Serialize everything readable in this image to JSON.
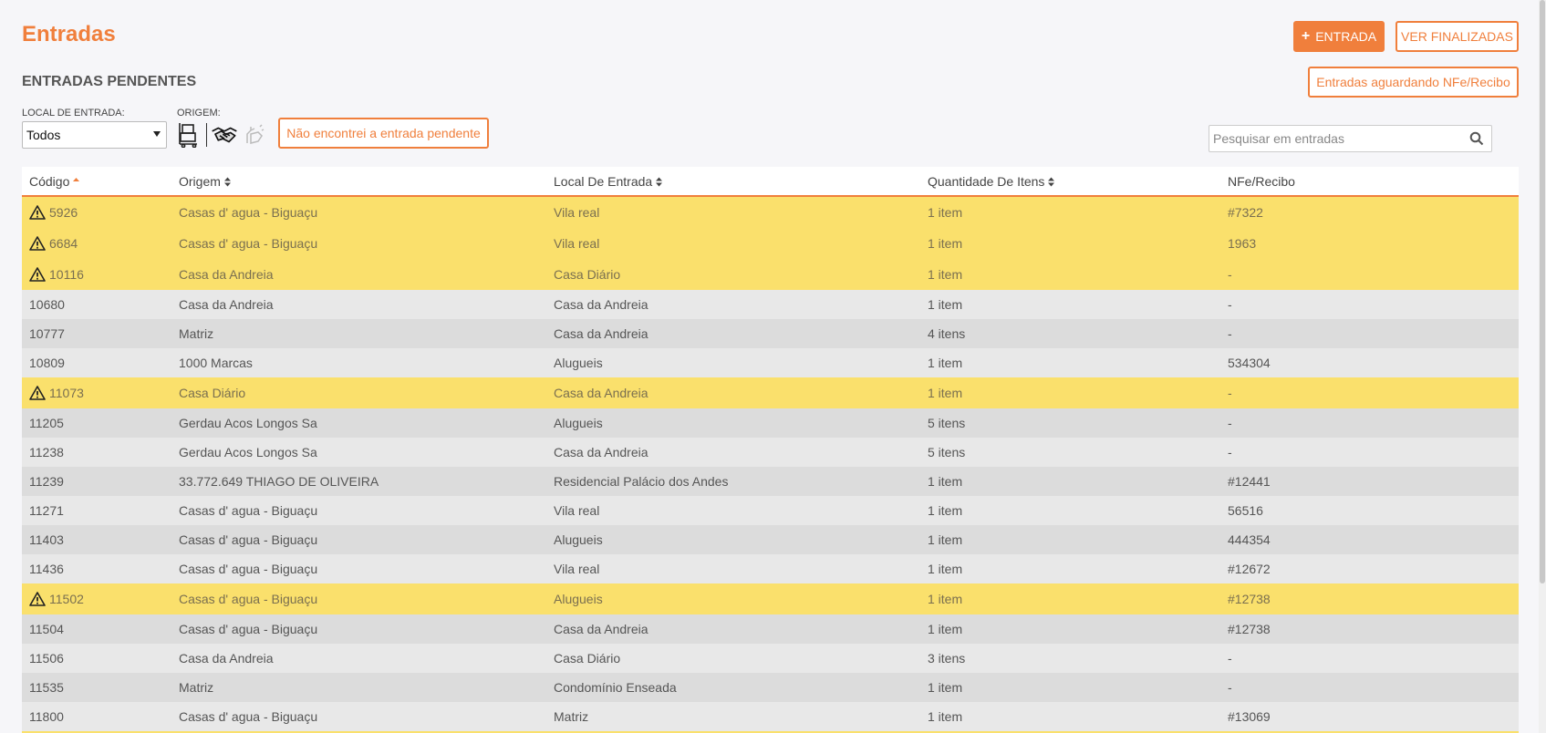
{
  "header": {
    "title": "Entradas",
    "new_button": "ENTRADA",
    "finalizadas_button": "VER FINALIZADAS",
    "aguardando_button": "Entradas aguardando NFe/Recibo"
  },
  "section": {
    "title": "ENTRADAS PENDENTES"
  },
  "filters": {
    "local_label": "LOCAL DE ENTRADA:",
    "local_value": "Todos",
    "origem_label": "ORIGEM:",
    "origem_icons": [
      "hand-truck-icon",
      "handshake-icon",
      "hand-gesture-icon"
    ],
    "nao_encontrei_button": "Não encontrei a entrada pendente",
    "search_placeholder": "Pesquisar em entradas"
  },
  "colors": {
    "accent": "#f07f3c",
    "warning_row": "#fae06c"
  },
  "table": {
    "columns": [
      "Código",
      "Origem",
      "Local De Entrada",
      "Quantidade De Itens",
      "NFe/Recibo"
    ],
    "rows": [
      {
        "warn": true,
        "codigo": "5926",
        "origem": "Casas d' agua - Biguaçu",
        "local": "Vila real",
        "qtd": "1 item",
        "nfe": "#7322"
      },
      {
        "warn": true,
        "codigo": "6684",
        "origem": "Casas d' agua - Biguaçu",
        "local": "Vila real",
        "qtd": "1 item",
        "nfe": "1963"
      },
      {
        "warn": true,
        "codigo": "10116",
        "origem": "Casa da Andreia",
        "local": "Casa Diário",
        "qtd": "1 item",
        "nfe": "-"
      },
      {
        "warn": false,
        "codigo": "10680",
        "origem": "Casa da Andreia",
        "local": "Casa da Andreia",
        "qtd": "1 item",
        "nfe": "-"
      },
      {
        "warn": false,
        "codigo": "10777",
        "origem": "Matriz",
        "local": "Casa da Andreia",
        "qtd": "4 itens",
        "nfe": "-"
      },
      {
        "warn": false,
        "codigo": "10809",
        "origem": "1000 Marcas",
        "local": "Alugueis",
        "qtd": "1 item",
        "nfe": "534304"
      },
      {
        "warn": true,
        "codigo": "11073",
        "origem": "Casa Diário",
        "local": "Casa da Andreia",
        "qtd": "1 item",
        "nfe": "-"
      },
      {
        "warn": false,
        "codigo": "11205",
        "origem": "Gerdau Acos Longos Sa",
        "local": "Alugueis",
        "qtd": "5 itens",
        "nfe": "-"
      },
      {
        "warn": false,
        "codigo": "11238",
        "origem": "Gerdau Acos Longos Sa",
        "local": "Casa da Andreia",
        "qtd": "5 itens",
        "nfe": "-"
      },
      {
        "warn": false,
        "codigo": "11239",
        "origem": "33.772.649 THIAGO DE OLIVEIRA",
        "local": "Residencial Palácio dos Andes",
        "qtd": "1 item",
        "nfe": "#12441"
      },
      {
        "warn": false,
        "codigo": "11271",
        "origem": "Casas d' agua - Biguaçu",
        "local": "Vila real",
        "qtd": "1 item",
        "nfe": "56516"
      },
      {
        "warn": false,
        "codigo": "11403",
        "origem": "Casas d' agua - Biguaçu",
        "local": "Alugueis",
        "qtd": "1 item",
        "nfe": "444354"
      },
      {
        "warn": false,
        "codigo": "11436",
        "origem": "Casas d' agua - Biguaçu",
        "local": "Vila real",
        "qtd": "1 item",
        "nfe": "#12672"
      },
      {
        "warn": true,
        "codigo": "11502",
        "origem": "Casas d' agua - Biguaçu",
        "local": "Alugueis",
        "qtd": "1 item",
        "nfe": "#12738"
      },
      {
        "warn": false,
        "codigo": "11504",
        "origem": "Casas d' agua - Biguaçu",
        "local": "Casa da Andreia",
        "qtd": "1 item",
        "nfe": "#12738"
      },
      {
        "warn": false,
        "codigo": "11506",
        "origem": "Casa da Andreia",
        "local": "Casa Diário",
        "qtd": "3 itens",
        "nfe": "-"
      },
      {
        "warn": false,
        "codigo": "11535",
        "origem": "Matriz",
        "local": "Condomínio Enseada",
        "qtd": "1 item",
        "nfe": "-"
      },
      {
        "warn": false,
        "codigo": "11800",
        "origem": "Casas d' agua - Biguaçu",
        "local": "Matriz",
        "qtd": "1 item",
        "nfe": "#13069"
      }
    ]
  }
}
